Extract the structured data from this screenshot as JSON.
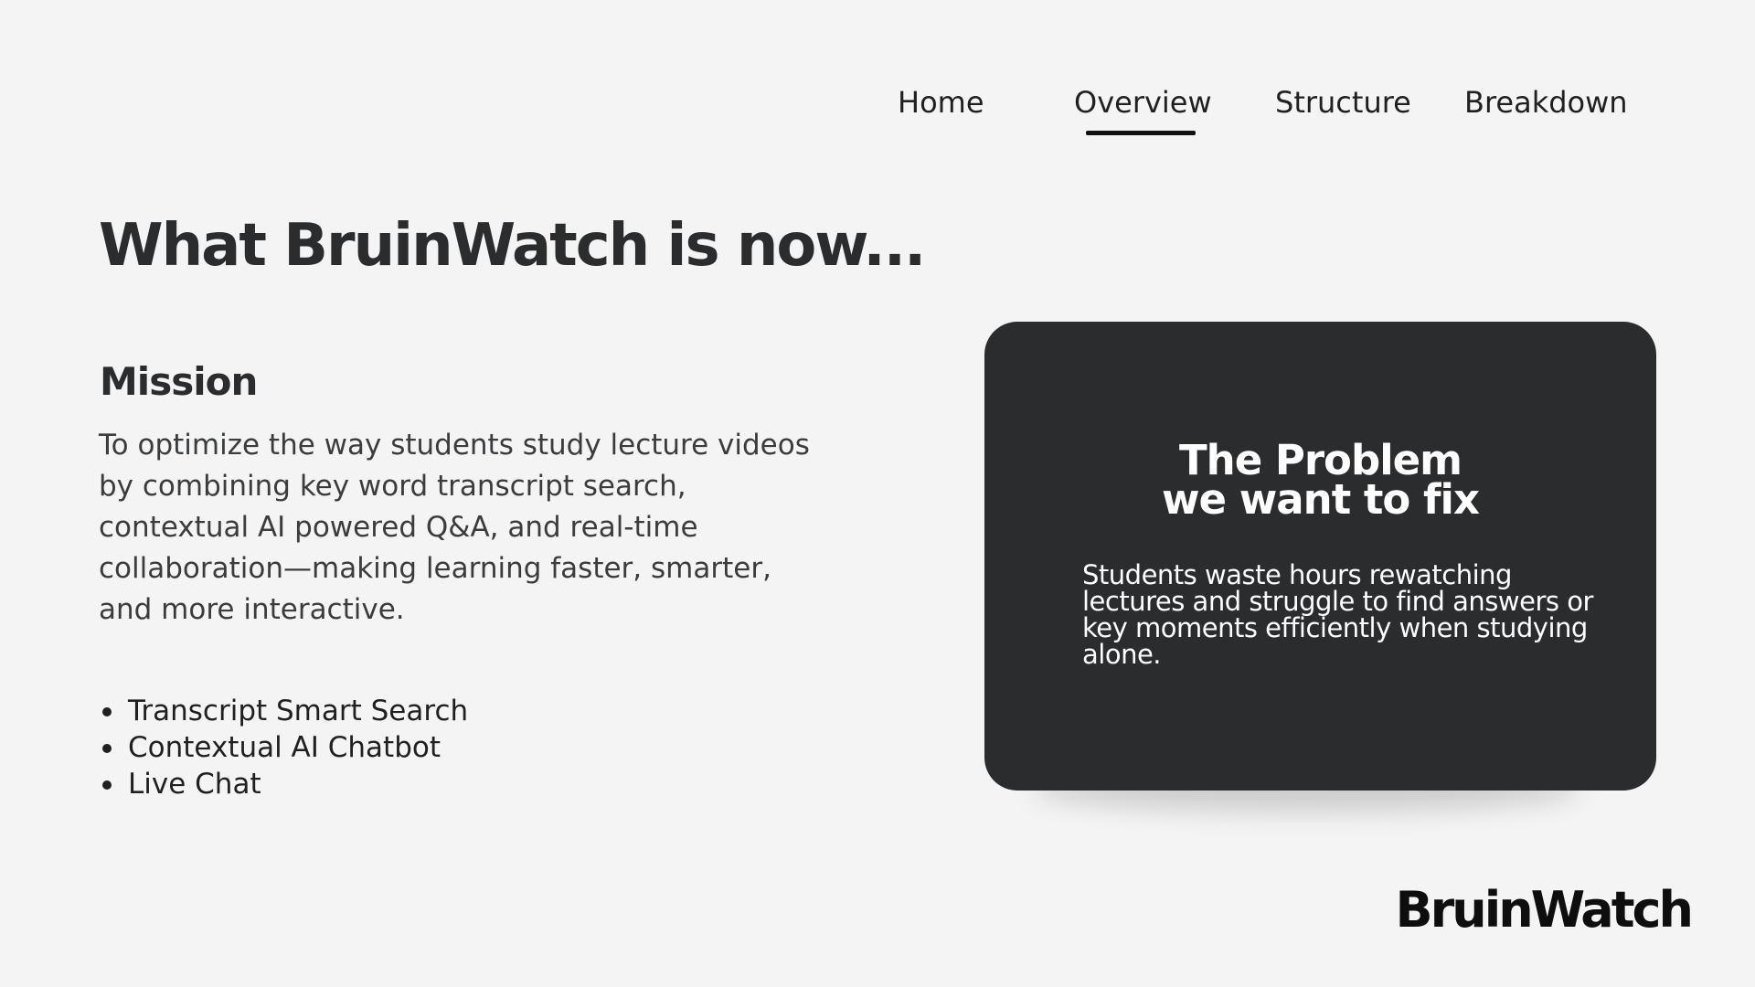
{
  "nav": {
    "items": [
      {
        "label": "Home"
      },
      {
        "label": "Overview",
        "active": true
      },
      {
        "label": "Structure"
      },
      {
        "label": "Breakdown"
      }
    ]
  },
  "page": {
    "title": "What BruinWatch is now..."
  },
  "mission": {
    "heading": "Mission",
    "text": "To optimize the way students study lecture videos by combining key word transcript search, contextual AI powered Q&A, and real-time collaboration—making learning faster, smarter, and more interactive."
  },
  "features": [
    {
      "label": "Transcript Smart Search"
    },
    {
      "label": "Contextual AI Chatbot"
    },
    {
      "label": "Live Chat"
    }
  ],
  "problem_card": {
    "title_line1": "The Problem",
    "title_line2": "we want to fix",
    "text": "Students waste hours rewatching lectures and struggle to find answers or key moments efficiently when studying alone."
  },
  "brand": {
    "logo_text": "BruinWatch"
  },
  "colors": {
    "background": "#f4f4f4",
    "card": "#2b2c2e",
    "text_dark": "#2b2c2e",
    "text_light": "#ffffff"
  }
}
